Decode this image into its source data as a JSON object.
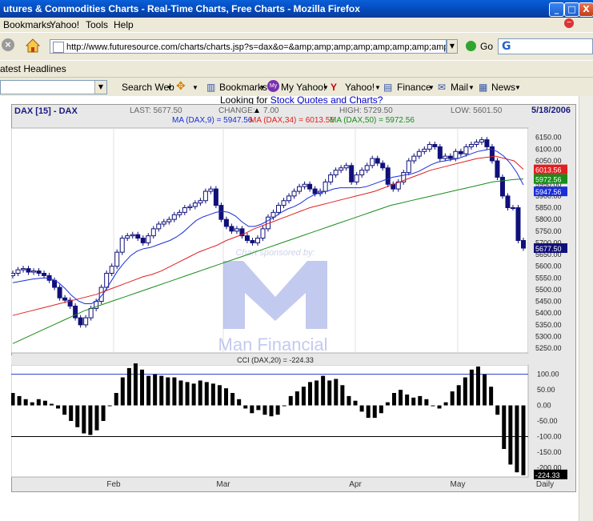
{
  "window": {
    "title": "utures & Commodities Charts - Real-Time Charts, Free Charts - Mozilla Firefox",
    "controls": [
      "_",
      "□",
      "X"
    ]
  },
  "menu": [
    "Bookmarks",
    "Yahoo!",
    "Tools",
    "Help"
  ],
  "nav": {
    "url": "http://www.futuresource.com/charts/charts.jsp?s=dax&o=&amp;amp;amp;amp;amp;amp;amp;amp;amp;a=D&",
    "go_label": "Go",
    "search_letter": "G"
  },
  "headlines_label": "atest Headlines",
  "yahoo_toolbar": {
    "search_web": "Search Web",
    "bookmarks": "Bookmarks",
    "my_yahoo": "My Yahoo!",
    "yahoo": "Yahoo!",
    "finance": "Finance",
    "mail": "Mail",
    "news": "News"
  },
  "page": {
    "promo_prefix": "Looking for ",
    "promo_link": "Stock Quotes and Charts?"
  },
  "quote": {
    "symbol": "DAX [15] - DAX",
    "last": "LAST: 5677.50",
    "change_label": "CHANGE:",
    "change_value": "7.00",
    "high": "HIGH: 5729.50",
    "low": "LOW: 5601.50",
    "date": "5/18/2006"
  },
  "ma_legend": {
    "ma9": "MA (DAX,9) = 5947.56",
    "ma34": "MA (DAX,34) = 6013.56",
    "ma50": "MA (DAX,50) = 5972.56"
  },
  "watermark": {
    "sponsor": "Chart sponsored by:",
    "brand": "Man Financial"
  },
  "colors": {
    "ma9": "#1b2fd6",
    "ma34": "#e02020",
    "ma50": "#1a8c1a",
    "candle": "#10107a",
    "cci_line": "#2b3cc8"
  },
  "chart_data": [
    {
      "type": "candlestick",
      "title": "DAX [15] - DAX",
      "x_labels": [
        "Feb",
        "Mar",
        "Apr",
        "May",
        "Daily"
      ],
      "y_ticks": [
        "6150.00",
        "6100.00",
        "6050.00",
        "6000.00",
        "5950.00",
        "5900.00",
        "5850.00",
        "5800.00",
        "5750.00",
        "5700.00",
        "5650.00",
        "5600.00",
        "5550.00",
        "5500.00",
        "5450.00",
        "5400.00",
        "5350.00",
        "5300.00",
        "5250.00"
      ],
      "ylim": [
        5230,
        6190
      ],
      "price_labels": {
        "ma34": "6013.56",
        "ma50": "5972.56",
        "ma9": "5947.56",
        "last": "5677.50"
      },
      "close": [
        5570,
        5585,
        5590,
        5575,
        5580,
        5570,
        5560,
        5540,
        5510,
        5465,
        5455,
        5430,
        5380,
        5350,
        5380,
        5420,
        5450,
        5510,
        5570,
        5600,
        5660,
        5720,
        5730,
        5735,
        5720,
        5700,
        5730,
        5760,
        5780,
        5790,
        5800,
        5820,
        5830,
        5850,
        5855,
        5870,
        5880,
        5920,
        5930,
        5860,
        5800,
        5770,
        5750,
        5760,
        5730,
        5710,
        5700,
        5720,
        5760,
        5810,
        5830,
        5860,
        5880,
        5900,
        5920,
        5940,
        5950,
        5930,
        5910,
        5920,
        5960,
        5990,
        6010,
        6020,
        6030,
        5960,
        5990,
        6010,
        6030,
        6060,
        6040,
        6020,
        5950,
        5930,
        5960,
        6000,
        6050,
        6070,
        6090,
        6100,
        6120,
        6110,
        6060,
        6070,
        6060,
        6090,
        6080,
        6110,
        6120,
        6130,
        6140,
        6110,
        6050,
        5980,
        5900,
        5850,
        5850,
        5710,
        5677.5
      ],
      "ma9": [
        5530,
        5535,
        5540,
        5545,
        5548,
        5550,
        5545,
        5530,
        5505,
        5475,
        5452,
        5440,
        5440,
        5455,
        5490,
        5535,
        5580,
        5615,
        5645,
        5665,
        5675,
        5680,
        5690,
        5700,
        5710,
        5725,
        5745,
        5770,
        5795,
        5810,
        5820,
        5830,
        5835,
        5830,
        5815,
        5790,
        5770,
        5770,
        5780,
        5795,
        5810,
        5830,
        5845,
        5855,
        5870,
        5890,
        5905,
        5915,
        5920,
        5930,
        5935,
        5935,
        5935,
        5935,
        5940,
        5950,
        5960,
        5970,
        5980,
        5985,
        5990,
        5995,
        6005,
        6020,
        6035,
        6045,
        6050,
        6055,
        6060,
        6070,
        6080,
        6090,
        6095,
        6100,
        6090,
        6070,
        6040,
        6000,
        5947.56
      ],
      "ma34": [
        5390,
        5400,
        5410,
        5420,
        5430,
        5440,
        5450,
        5460,
        5470,
        5480,
        5495,
        5510,
        5525,
        5540,
        5555,
        5565,
        5580,
        5600,
        5620,
        5640,
        5660,
        5675,
        5690,
        5710,
        5725,
        5740,
        5760,
        5775,
        5790,
        5805,
        5820,
        5835,
        5850,
        5860,
        5870,
        5880,
        5890,
        5900,
        5910,
        5920,
        5935,
        5950,
        5965,
        5980,
        5995,
        6010,
        6020,
        6030,
        6040,
        6050,
        6060,
        6065,
        6070,
        6060,
        6050,
        6013.56
      ],
      "ma50": [
        5270,
        5290,
        5310,
        5330,
        5350,
        5370,
        5390,
        5410,
        5425,
        5440,
        5455,
        5470,
        5485,
        5500,
        5515,
        5530,
        5545,
        5560,
        5575,
        5590,
        5605,
        5620,
        5635,
        5650,
        5665,
        5680,
        5695,
        5710,
        5725,
        5740,
        5755,
        5770,
        5785,
        5800,
        5815,
        5830,
        5845,
        5860,
        5870,
        5880,
        5890,
        5900,
        5910,
        5920,
        5930,
        5940,
        5950,
        5960,
        5965,
        5970,
        5972.56
      ]
    },
    {
      "type": "bar",
      "title": "CCI (DAX,20) = -224.33",
      "y_ticks": [
        "100.00",
        "50.00",
        "0.00",
        "-50.00",
        "-100.00",
        "-150.00",
        "-200.00"
      ],
      "ylim": [
        -230,
        130
      ],
      "ref_lines": [
        100,
        -100
      ],
      "last_label": "-224.33",
      "values": [
        40,
        30,
        20,
        10,
        20,
        15,
        5,
        -10,
        -30,
        -50,
        -70,
        -90,
        -95,
        -80,
        -50,
        0,
        40,
        90,
        120,
        135,
        115,
        95,
        100,
        95,
        90,
        90,
        80,
        75,
        70,
        80,
        75,
        70,
        65,
        55,
        40,
        20,
        -10,
        -25,
        -15,
        -30,
        -35,
        -30,
        0,
        30,
        45,
        60,
        75,
        80,
        95,
        80,
        85,
        65,
        30,
        15,
        -20,
        -40,
        -40,
        -25,
        10,
        40,
        50,
        35,
        25,
        30,
        20,
        0,
        -10,
        10,
        45,
        65,
        90,
        115,
        125,
        100,
        60,
        -30,
        -140,
        -190,
        -215,
        -224.33
      ]
    }
  ]
}
